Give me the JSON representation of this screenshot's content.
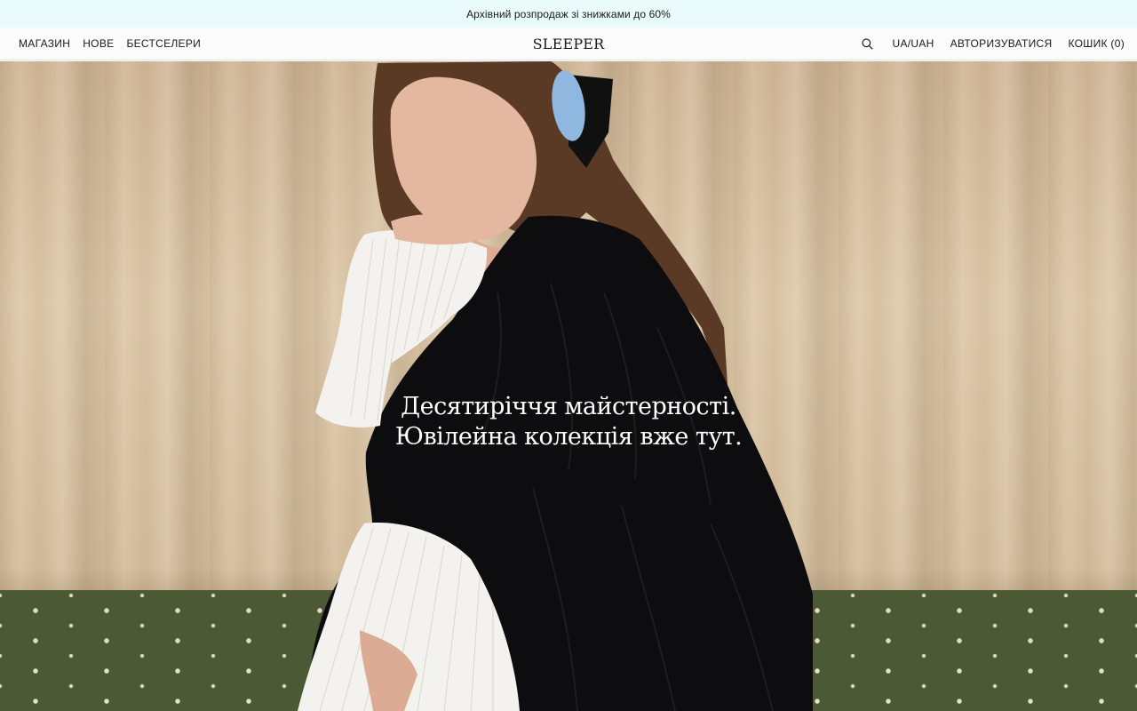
{
  "promo": {
    "text": "Архівний розпродаж зі знижками до 60%"
  },
  "header": {
    "nav_left": [
      "МАГАЗИН",
      "НОВЕ",
      "БЕСТСЕЛЕРИ"
    ],
    "logo": "SLEEPER",
    "locale": "UA/UAH",
    "login": "АВТОРИЗУВАТИСЯ",
    "cart": "КОШИК (0)",
    "search_icon": "search-icon"
  },
  "hero": {
    "headline_line1": "Десятиріччя майстерності.",
    "headline_line2": "Ювілейна колекція вже тут."
  },
  "colors": {
    "promo_bg": "#e9fbfa",
    "header_bg": "#fbfbfb",
    "curtain": "#d7c0a1",
    "carpet": "#4b5a34",
    "dress": "#0d0d0f"
  }
}
